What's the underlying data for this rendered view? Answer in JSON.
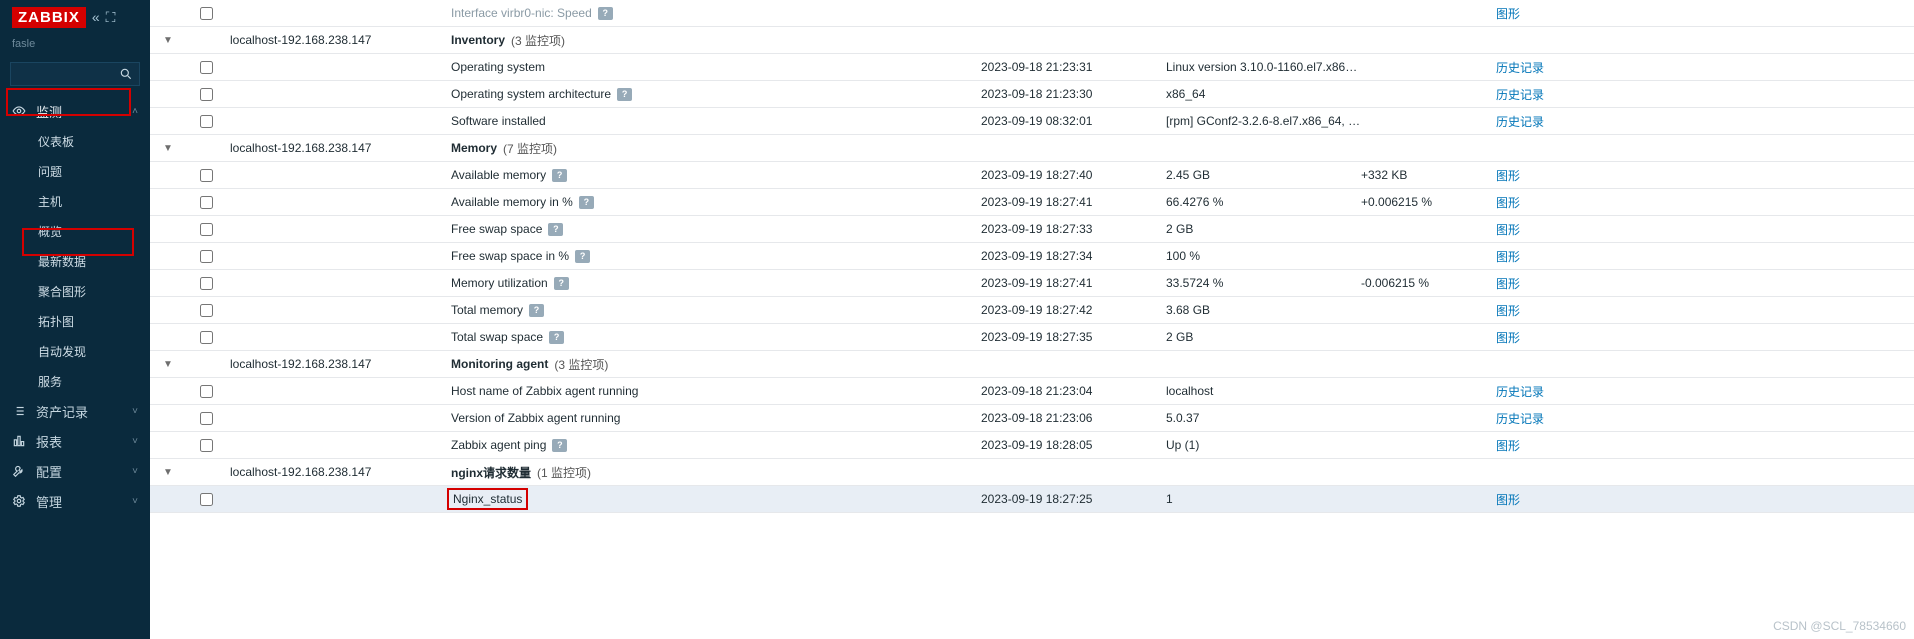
{
  "brand": "ZABBIX",
  "user": "fasle",
  "watermark": "CSDN @SCL_78534660",
  "sidebar": {
    "sections": [
      {
        "icon": "eye",
        "label": "监测",
        "open": true,
        "items": [
          {
            "label": "仪表板"
          },
          {
            "label": "问题"
          },
          {
            "label": "主机"
          },
          {
            "label": "概览"
          },
          {
            "label": "最新数据"
          },
          {
            "label": "聚合图形"
          },
          {
            "label": "拓扑图"
          },
          {
            "label": "自动发现"
          },
          {
            "label": "服务"
          }
        ]
      },
      {
        "icon": "list",
        "label": "资产记录",
        "open": false
      },
      {
        "icon": "bar",
        "label": "报表",
        "open": false
      },
      {
        "icon": "wrench",
        "label": "配置",
        "open": false
      },
      {
        "icon": "gear",
        "label": "管理",
        "open": false
      }
    ]
  },
  "links": {
    "graph": "图形",
    "history": "历史记录"
  },
  "hostname": "localhost-192.168.238.147",
  "topOrphan": {
    "name": "Interface virbr0-nic: Speed",
    "q": true,
    "link": "graph"
  },
  "groups": [
    {
      "title": "Inventory",
      "count": "3 监控项",
      "items": [
        {
          "name": "Operating system",
          "q": false,
          "time": "2023-09-18 21:23:31",
          "val": "Linux version 3.10.0-1160.el7.x86_6...",
          "chg": "",
          "link": "history"
        },
        {
          "name": "Operating system architecture",
          "q": true,
          "time": "2023-09-18 21:23:30",
          "val": "x86_64",
          "chg": "",
          "link": "history"
        },
        {
          "name": "Software installed",
          "q": false,
          "time": "2023-09-19 08:32:01",
          "val": "[rpm] GConf2-3.2.6-8.el7.x86_64, G...",
          "chg": "",
          "link": "history"
        }
      ]
    },
    {
      "title": "Memory",
      "count": "7 监控项",
      "items": [
        {
          "name": "Available memory",
          "q": true,
          "time": "2023-09-19 18:27:40",
          "val": "2.45 GB",
          "chg": "+332 KB",
          "link": "graph"
        },
        {
          "name": "Available memory in %",
          "q": true,
          "time": "2023-09-19 18:27:41",
          "val": "66.4276 %",
          "chg": "+0.006215 %",
          "link": "graph"
        },
        {
          "name": "Free swap space",
          "q": true,
          "time": "2023-09-19 18:27:33",
          "val": "2 GB",
          "chg": "",
          "link": "graph"
        },
        {
          "name": "Free swap space in %",
          "q": true,
          "time": "2023-09-19 18:27:34",
          "val": "100 %",
          "chg": "",
          "link": "graph"
        },
        {
          "name": "Memory utilization",
          "q": true,
          "time": "2023-09-19 18:27:41",
          "val": "33.5724 %",
          "chg": "-0.006215 %",
          "link": "graph"
        },
        {
          "name": "Total memory",
          "q": true,
          "time": "2023-09-19 18:27:42",
          "val": "3.68 GB",
          "chg": "",
          "link": "graph"
        },
        {
          "name": "Total swap space",
          "q": true,
          "time": "2023-09-19 18:27:35",
          "val": "2 GB",
          "chg": "",
          "link": "graph"
        }
      ]
    },
    {
      "title": "Monitoring agent",
      "count": "3 监控项",
      "items": [
        {
          "name": "Host name of Zabbix agent running",
          "q": false,
          "time": "2023-09-18 21:23:04",
          "val": "localhost",
          "chg": "",
          "link": "history"
        },
        {
          "name": "Version of Zabbix agent running",
          "q": false,
          "time": "2023-09-18 21:23:06",
          "val": "5.0.37",
          "chg": "",
          "link": "history"
        },
        {
          "name": "Zabbix agent ping",
          "q": true,
          "time": "2023-09-19 18:28:05",
          "val": "Up (1)",
          "chg": "",
          "link": "graph"
        }
      ]
    },
    {
      "title": "nginx请求数量",
      "count": "1 监控项",
      "items": [
        {
          "name": "Nginx_status",
          "q": false,
          "time": "2023-09-19 18:27:25",
          "val": "1",
          "chg": "",
          "link": "graph",
          "hl": true,
          "rowhl": true
        }
      ]
    }
  ]
}
